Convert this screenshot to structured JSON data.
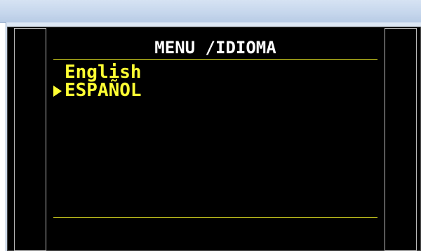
{
  "screen": {
    "title": "MENU /IDIOMA",
    "items": [
      {
        "label": "English",
        "selected": false
      },
      {
        "label": "ESPAÑOL",
        "selected": true
      }
    ],
    "cursor_icon": "triangle-right",
    "colors": {
      "background": "#000000",
      "title": "#ffffff",
      "item": "#ffff33",
      "rule": "#d8d820"
    }
  }
}
